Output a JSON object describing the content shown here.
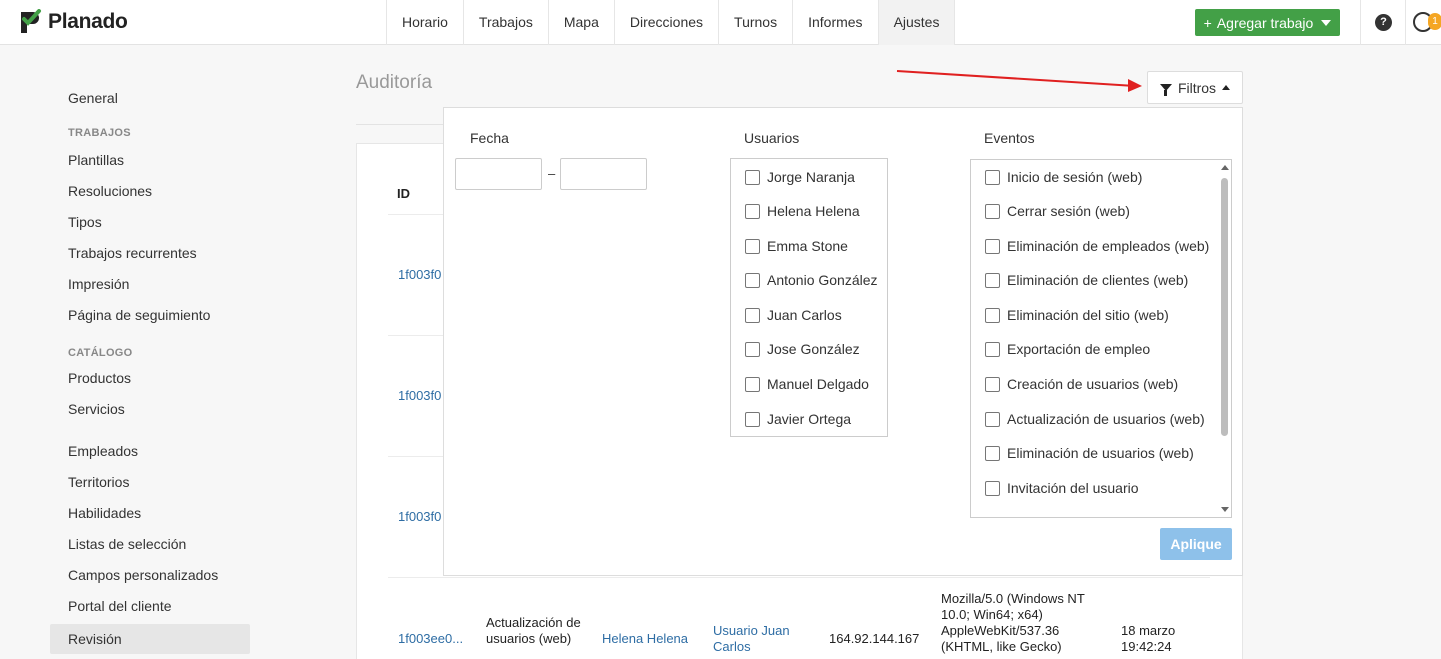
{
  "app": {
    "logo_text": "Planado"
  },
  "nav": {
    "items": [
      {
        "label": "Horario",
        "active": false
      },
      {
        "label": "Trabajos",
        "active": false
      },
      {
        "label": "Mapa",
        "active": false
      },
      {
        "label": "Direcciones",
        "active": false
      },
      {
        "label": "Turnos",
        "active": false
      },
      {
        "label": "Informes",
        "active": false
      },
      {
        "label": "Ajustes",
        "active": true
      }
    ],
    "add_button": "Agregar trabajo",
    "help_icon": "?",
    "notification_count": "1"
  },
  "sidebar": {
    "general": "General",
    "trabajos_head": "TRABAJOS",
    "trabajos": [
      "Plantillas",
      "Resoluciones",
      "Tipos",
      "Trabajos recurrentes",
      "Impresión",
      "Página de seguimiento"
    ],
    "catalogo_head": "CATÁLOGO",
    "catalogo": [
      "Productos",
      "Servicios"
    ],
    "others": [
      "Empleados",
      "Territorios",
      "Habilidades",
      "Listas de selección",
      "Campos personalizados",
      "Portal del cliente",
      "Revisión"
    ]
  },
  "page": {
    "title": "Auditoría"
  },
  "table": {
    "id_header": "ID",
    "rows": [
      {
        "id": "1f003f0"
      },
      {
        "id": "1f003f0"
      },
      {
        "id": "1f003f0"
      },
      {
        "id": "1f003ee0...",
        "event": "Actualización de usuarios (web)",
        "user": "Helena Helena",
        "target": "Usuario Juan Carlos",
        "ip": "164.92.144.167",
        "agent": "Mozilla/5.0 (Windows NT 10.0; Win64; x64) AppleWebKit/537.36 (KHTML, like Gecko)",
        "date": "18 marzo 19:42:24"
      }
    ]
  },
  "filter": {
    "button_label": "Filtros",
    "fecha_label": "Fecha",
    "date_from": "",
    "date_to": "",
    "dash": "–",
    "usuarios_label": "Usuarios",
    "usuarios": [
      "Jorge Naranja",
      "Helena Helena",
      "Emma Stone",
      "Antonio González",
      "Juan Carlos",
      "Jose González",
      "Manuel Delgado",
      "Javier Ortega"
    ],
    "eventos_label": "Eventos",
    "eventos": [
      "Inicio de sesión (web)",
      "Cerrar sesión (web)",
      "Eliminación de empleados (web)",
      "Eliminación de clientes (web)",
      "Eliminación del sitio (web)",
      "Exportación de empleo",
      "Creación de usuarios (web)",
      "Actualización de usuarios (web)",
      "Eliminación de usuarios (web)",
      "Invitación del usuario"
    ],
    "apply_label": "Aplique"
  },
  "colors": {
    "brand_green": "#43a047",
    "link_blue": "#2e6da4",
    "apply_blue": "#8ec1ea",
    "annotation_red": "#e02020",
    "badge_orange": "#f5a623"
  }
}
